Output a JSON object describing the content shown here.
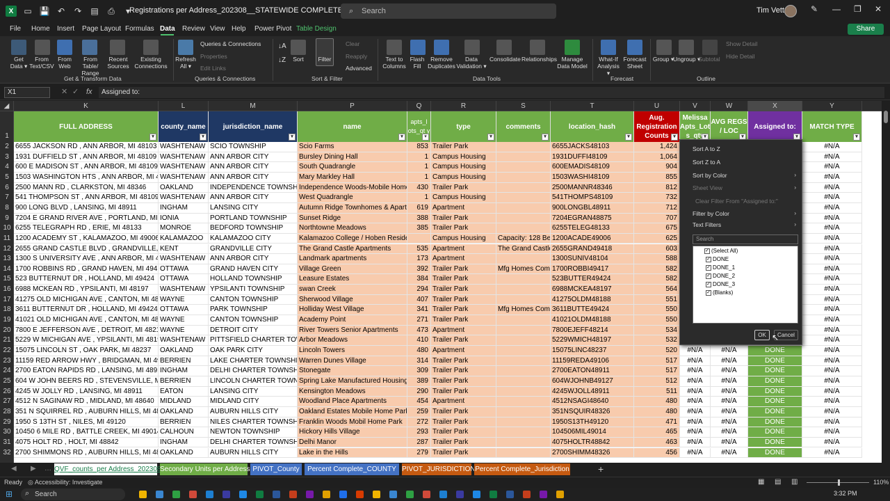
{
  "title_bar": {
    "document": "Registrations per Address_202308__STATEWIDE COMPLETED_4.xlsx  -  Excel",
    "search": "Search",
    "user": "Tim Vetter"
  },
  "menu": {
    "items": [
      "File",
      "Home",
      "Insert",
      "Page Layout",
      "Formulas",
      "Data",
      "Review",
      "View",
      "Help",
      "Power Pivot",
      "Table Design"
    ],
    "share": "Share"
  },
  "ribbon": {
    "get_data": "Get Data ▾",
    "from_text": "From Text/CSV",
    "from_web": "From Web",
    "from_table": "From Table/ Range",
    "recent": "Recent Sources",
    "existing": "Existing Connections",
    "refresh": "Refresh All ▾",
    "queries": "Queries & Connections",
    "properties": "Properties",
    "edit_links": "Edit Links",
    "sort": "Sort",
    "filter": "Filter",
    "clear": "Clear",
    "reapply": "Reapply",
    "advanced": "Advanced",
    "text_to_columns": "Text to Columns",
    "flash_fill": "Flash Fill",
    "remove_dup": "Remove Duplicates",
    "data_validation": "Data Validation ▾",
    "consolidate": "Consolidate",
    "relationships": "Relationships",
    "manage_model": "Manage Data Model",
    "what_if": "What-If Analysis ▾",
    "forecast": "Forecast Sheet",
    "group": "Group ▾",
    "ungroup": "Ungroup ▾",
    "subtotal": "Subtotal",
    "show_detail": "Show Detail",
    "hide_detail": "Hide Detail",
    "groups": [
      "Get & Transform Data",
      "Queries & Connections",
      "Sort & Filter",
      "Data Tools",
      "Forecast",
      "Outline"
    ]
  },
  "formula_bar": {
    "cell": "X1",
    "formula": "Assigned to:"
  },
  "columns": [
    "K",
    "L",
    "M",
    "P",
    "Q",
    "R",
    "S",
    "T",
    "U",
    "V",
    "W",
    "X",
    "Y"
  ],
  "headers": {
    "full_address": "FULL ADDRESS",
    "county": "county_name",
    "jurisdiction": "jurisdiction_name",
    "name": "name",
    "apts": "apts_l ots_qt y",
    "type": "type",
    "comments": "comments",
    "location_hash": "location_hash",
    "aug": "Aug. Registration Counts",
    "melissa": "Melissa Apts_Lot s_qty",
    "avg": "AVG REGS / LOC",
    "assigned": "Assigned to:",
    "match": "MATCH TYPE"
  },
  "rows": [
    [
      "2",
      "6655  JACKSON RD , ANN ARBOR, MI 48103",
      "WASHTENAW",
      "SCIO TOWNSHIP",
      "Scio Farms",
      "853",
      "Trailer Park",
      "",
      "6655JACKS48103",
      "1,424",
      "",
      "",
      "",
      "#N/A"
    ],
    [
      "3",
      "1931  DUFFIELD ST , ANN ARBOR, MI 48109",
      "WASHTENAW",
      "ANN ARBOR CITY",
      "Bursley Dining Hall",
      "1",
      "Campus Housing",
      "",
      "1931DUFFI48109",
      "1,064",
      "",
      "",
      "",
      "#N/A"
    ],
    [
      "4",
      "600 E MADISON ST , ANN ARBOR, MI 48109",
      "WASHTENAW",
      "ANN ARBOR CITY",
      "South Quadrangle",
      "1",
      "Campus Housing",
      "",
      "600EMADIS48109",
      "904",
      "",
      "",
      "",
      "#N/A"
    ],
    [
      "5",
      "1503  WASHINGTON HTS , ANN ARBOR, MI 481",
      "WASHTENAW",
      "ANN ARBOR CITY",
      "Mary Markley Hall",
      "1",
      "Campus Housing",
      "",
      "1503WASHI48109",
      "855",
      "",
      "",
      "",
      "#N/A"
    ],
    [
      "6",
      "2500  MANN RD , CLARKSTON, MI 48346",
      "OAKLAND",
      "INDEPENDENCE TOWNSHIP",
      "Independence Woods-Mobile Home",
      "430",
      "Trailer Park",
      "",
      "2500MANNR48346",
      "812",
      "",
      "",
      "",
      "#N/A"
    ],
    [
      "7",
      "541  THOMPSON ST , ANN ARBOR, MI 48109",
      "WASHTENAW",
      "ANN ARBOR CITY",
      "West Quadrangle",
      "1",
      "Campus Housing",
      "",
      "541THOMPS48109",
      "732",
      "",
      "",
      "",
      "#N/A"
    ],
    [
      "8",
      "900  LONG BLVD , LANSING, MI 48911",
      "INGHAM",
      "LANSING CITY",
      "Autumn Ridge Townhomes & Apartn",
      "619",
      "Apartment",
      "",
      "900LONGBL48911",
      "712",
      "",
      "",
      "",
      "#N/A"
    ],
    [
      "9",
      "7204 E GRAND RIVER AVE , PORTLAND, MI 488",
      "IONIA",
      "PORTLAND TOWNSHIP",
      "Sunset Ridge",
      "388",
      "Trailer Park",
      "",
      "7204EGRAN48875",
      "707",
      "",
      "",
      "",
      "#N/A"
    ],
    [
      "10",
      "6255  TELEGRAPH RD , ERIE, MI 48133",
      "MONROE",
      "BEDFORD TOWNSHIP",
      "Northtowne Meadows",
      "385",
      "Trailer Park",
      "",
      "6255TELEG48133",
      "675",
      "",
      "",
      "",
      "#N/A"
    ],
    [
      "11",
      "1200  ACADEMY ST , KALAMAZOO, MI 49006",
      "KALAMAZOO",
      "KALAMAZOO CITY",
      "Kalamazoo College / Hoben Residen",
      "",
      "Campus Housing",
      "Capacity: 128 Bec",
      "1200ACADE49006",
      "625",
      "",
      "",
      "",
      "#N/A"
    ],
    [
      "12",
      "2655  GRAND CASTLE BLVD , GRANDVILLE, MI 4",
      "KENT",
      "GRANDVILLE CITY",
      "The Grand Castle Apartments",
      "535",
      "Apartment",
      "The Grand Castle",
      "2655GRAND49418",
      "603",
      "",
      "",
      "",
      "#N/A"
    ],
    [
      "13",
      "1300 S UNIVERSITY AVE , ANN ARBOR, MI 4810",
      "WASHTENAW",
      "ANN ARBOR CITY",
      "Landmark apartments",
      "173",
      "Apartment",
      "",
      "1300SUNIV48104",
      "588",
      "",
      "",
      "",
      "#N/A"
    ],
    [
      "14",
      "1700  ROBBINS RD , GRAND HAVEN, MI 49417",
      "OTTAWA",
      "GRAND HAVEN CITY",
      "Village Green",
      "392",
      "Trailer Park",
      "Mfg Homes Comn",
      "1700ROBBI49417",
      "582",
      "",
      "",
      "",
      "#N/A"
    ],
    [
      "15",
      "523  BUTTERNUT DR , HOLLAND, MI 49424",
      "OTTAWA",
      "HOLLAND TOWNSHIP",
      "Leasure Estates",
      "384",
      "Trailer Park",
      "",
      "523BUTTER49424",
      "582",
      "",
      "",
      "",
      "#N/A"
    ],
    [
      "16",
      "6988  MCKEAN RD , YPSILANTI, MI 48197",
      "WASHTENAW",
      "YPSILANTI TOWNSHIP",
      "swan Creek",
      "294",
      "Trailer Park",
      "",
      "6988MCKEA48197",
      "564",
      "",
      "",
      "",
      "#N/A"
    ],
    [
      "17",
      "41275  OLD MICHIGAN AVE , CANTON, MI 4818",
      "WAYNE",
      "CANTON TOWNSHIP",
      "Sherwood Village",
      "407",
      "Trailer Park",
      "",
      "41275OLDM48188",
      "551",
      "",
      "",
      "",
      "#N/A"
    ],
    [
      "18",
      "3611  BUTTERNUT DR , HOLLAND, MI 49424",
      "OTTAWA",
      "PARK TOWNSHIP",
      "Holliday West Village",
      "341",
      "Trailer Park",
      "Mfg Homes Comn",
      "3611BUTTE49424",
      "550",
      "",
      "",
      "",
      "#N/A"
    ],
    [
      "19",
      "41021  OLD MICHIGAN AVE , CANTON, MI 4818",
      "WAYNE",
      "CANTON TOWNSHIP",
      "Academy Point",
      "271",
      "Trailer Park",
      "",
      "41021OLDM48188",
      "550",
      "",
      "",
      "",
      "#N/A"
    ],
    [
      "20",
      "7800 E JEFFERSON AVE , DETROIT, MI 48214",
      "WAYNE",
      "DETROIT CITY",
      "River Towers Senior Apartments",
      "473",
      "Apartment",
      "",
      "7800EJEFF48214",
      "534",
      "",
      "",
      "",
      "#N/A"
    ],
    [
      "21",
      "5229 W MICHIGAN AVE , YPSILANTI, MI 48197",
      "WASHTENAW",
      "PITTSFIELD CHARTER TOWNS",
      "Arbor Meadows",
      "410",
      "Trailer Park",
      "",
      "5229WMICH48197",
      "532",
      "",
      "",
      "",
      "#N/A"
    ],
    [
      "22",
      "15075  LINCOLN ST , OAK PARK, MI 48237",
      "OAKLAND",
      "OAK PARK CITY",
      "Lincoln Towers",
      "480",
      "Apartment",
      "",
      "15075LINC48237",
      "520",
      "#N/A",
      "#N/A",
      "DONE",
      "#N/A"
    ],
    [
      "23",
      "11159  RED ARROW HWY , BRIDGMAN, MI 491",
      "BERRIEN",
      "LAKE CHARTER TOWNSHIP",
      "Warren Dunes Village",
      "314",
      "Trailer Park",
      "",
      "11159REDA49106",
      "517",
      "#N/A",
      "#N/A",
      "DONE",
      "#N/A"
    ],
    [
      "24",
      "2700  EATON RAPIDS RD , LANSING, MI 48911",
      "INGHAM",
      "DELHI CHARTER TOWNSHIP",
      "Stonegate",
      "309",
      "Trailer Park",
      "",
      "2700EATON48911",
      "517",
      "#N/A",
      "#N/A",
      "DONE",
      "#N/A"
    ],
    [
      "25",
      "604 W JOHN BEERS RD , STEVENSVILLE, MI 491",
      "BERRIEN",
      "LINCOLN CHARTER TOWNSH",
      "Spring Lake Manufactured Housing",
      "389",
      "Trailer Park",
      "",
      "604WJOHNB49127",
      "512",
      "#N/A",
      "#N/A",
      "DONE",
      "#N/A"
    ],
    [
      "26",
      "4245 W JOLLY RD , LANSING, MI 48911",
      "EATON",
      "LANSING CITY",
      "Kensington Meadows",
      "290",
      "Trailer Park",
      "",
      "4245WJOLL48911",
      "511",
      "#N/A",
      "#N/A",
      "DONE",
      "#N/A"
    ],
    [
      "27",
      "4512 N SAGINAW RD , MIDLAND, MI 48640",
      "MIDLAND",
      "MIDLAND CITY",
      "Woodland Place Apartments",
      "454",
      "Apartment",
      "",
      "4512NSAGI48640",
      "480",
      "#N/A",
      "#N/A",
      "DONE",
      "#N/A"
    ],
    [
      "28",
      "351 N SQUIRREL RD , AUBURN HILLS, MI 48326",
      "OAKLAND",
      "AUBURN HILLS CITY",
      "Oakland Estates Mobile Home Park",
      "259",
      "Trailer Park",
      "",
      "351NSQUIR48326",
      "480",
      "#N/A",
      "#N/A",
      "DONE",
      "#N/A"
    ],
    [
      "29",
      "1950 S 13TH ST , NILES, MI 49120",
      "BERRIEN",
      "NILES CHARTER TOWNSHIP",
      "Franklin Woods Mobil Home Park",
      "272",
      "Trailer Park",
      "",
      "1950S13TH49120",
      "471",
      "#N/A",
      "#N/A",
      "DONE",
      "#N/A"
    ],
    [
      "30",
      "10450  6 MILE RD , BATTLE CREEK, MI 49014",
      "CALHOUN",
      "NEWTON TOWNSHIP",
      "Hickory Hills Village",
      "293",
      "Trailer Park",
      "",
      "104506MIL49014",
      "465",
      "#N/A",
      "#N/A",
      "DONE",
      "#N/A"
    ],
    [
      "31",
      "4075  HOLT RD , HOLT, MI 48842",
      "INGHAM",
      "DELHI CHARTER TOWNSHIP",
      "Delhi Manor",
      "287",
      "Trailer Park",
      "",
      "4075HOLTR48842",
      "463",
      "#N/A",
      "#N/A",
      "DONE",
      "#N/A"
    ],
    [
      "32",
      "2700  SHIMMONS RD , AUBURN HILLS, MI 4832",
      "OAKLAND",
      "AUBURN HILLS CITY",
      "Lake in the Hills",
      "279",
      "Trailer Park",
      "",
      "2700SHIMM48326",
      "456",
      "#N/A",
      "#N/A",
      "DONE",
      "#N/A"
    ]
  ],
  "filter_menu": {
    "sort_az": "Sort A to Z",
    "sort_za": "Sort Z to A",
    "sort_color": "Sort by Color",
    "sheet_view": "Sheet View",
    "clear_filter": "Clear Filter From \"Assigned to:\"",
    "filter_color": "Filter by Color",
    "text_filters": "Text Filters",
    "search": "Search",
    "items": [
      "(Select All)",
      "DONE",
      "DONE_1",
      "DONE_2",
      "DONE_3",
      "(Blanks)"
    ],
    "ok": "OK",
    "cancel": "Cancel"
  },
  "tabs": [
    {
      "label": "QVF_counts_per Address_202308",
      "color": "#ffffff",
      "text": "#1a7f4b"
    },
    {
      "label": "Secondary Units per Address",
      "color": "#70ad47",
      "text": "#ffffff"
    },
    {
      "label": "PIVOT_County",
      "color": "#4472c4",
      "text": "#ffffff"
    },
    {
      "label": "Percent Complete_COUNTY",
      "color": "#4472c4",
      "text": "#ffffff"
    },
    {
      "label": "PIVOT_JURISDICTION",
      "color": "#c55a11",
      "text": "#ffffff"
    },
    {
      "label": "Percent Complete_Jurisdiction",
      "color": "#c55a11",
      "text": "#ffffff"
    }
  ],
  "status": {
    "ready": "Ready",
    "accessibility": "Accessibility: Investigate",
    "zoom": "110%"
  },
  "taskbar": {
    "search": "Search",
    "time": "3:32 PM"
  }
}
